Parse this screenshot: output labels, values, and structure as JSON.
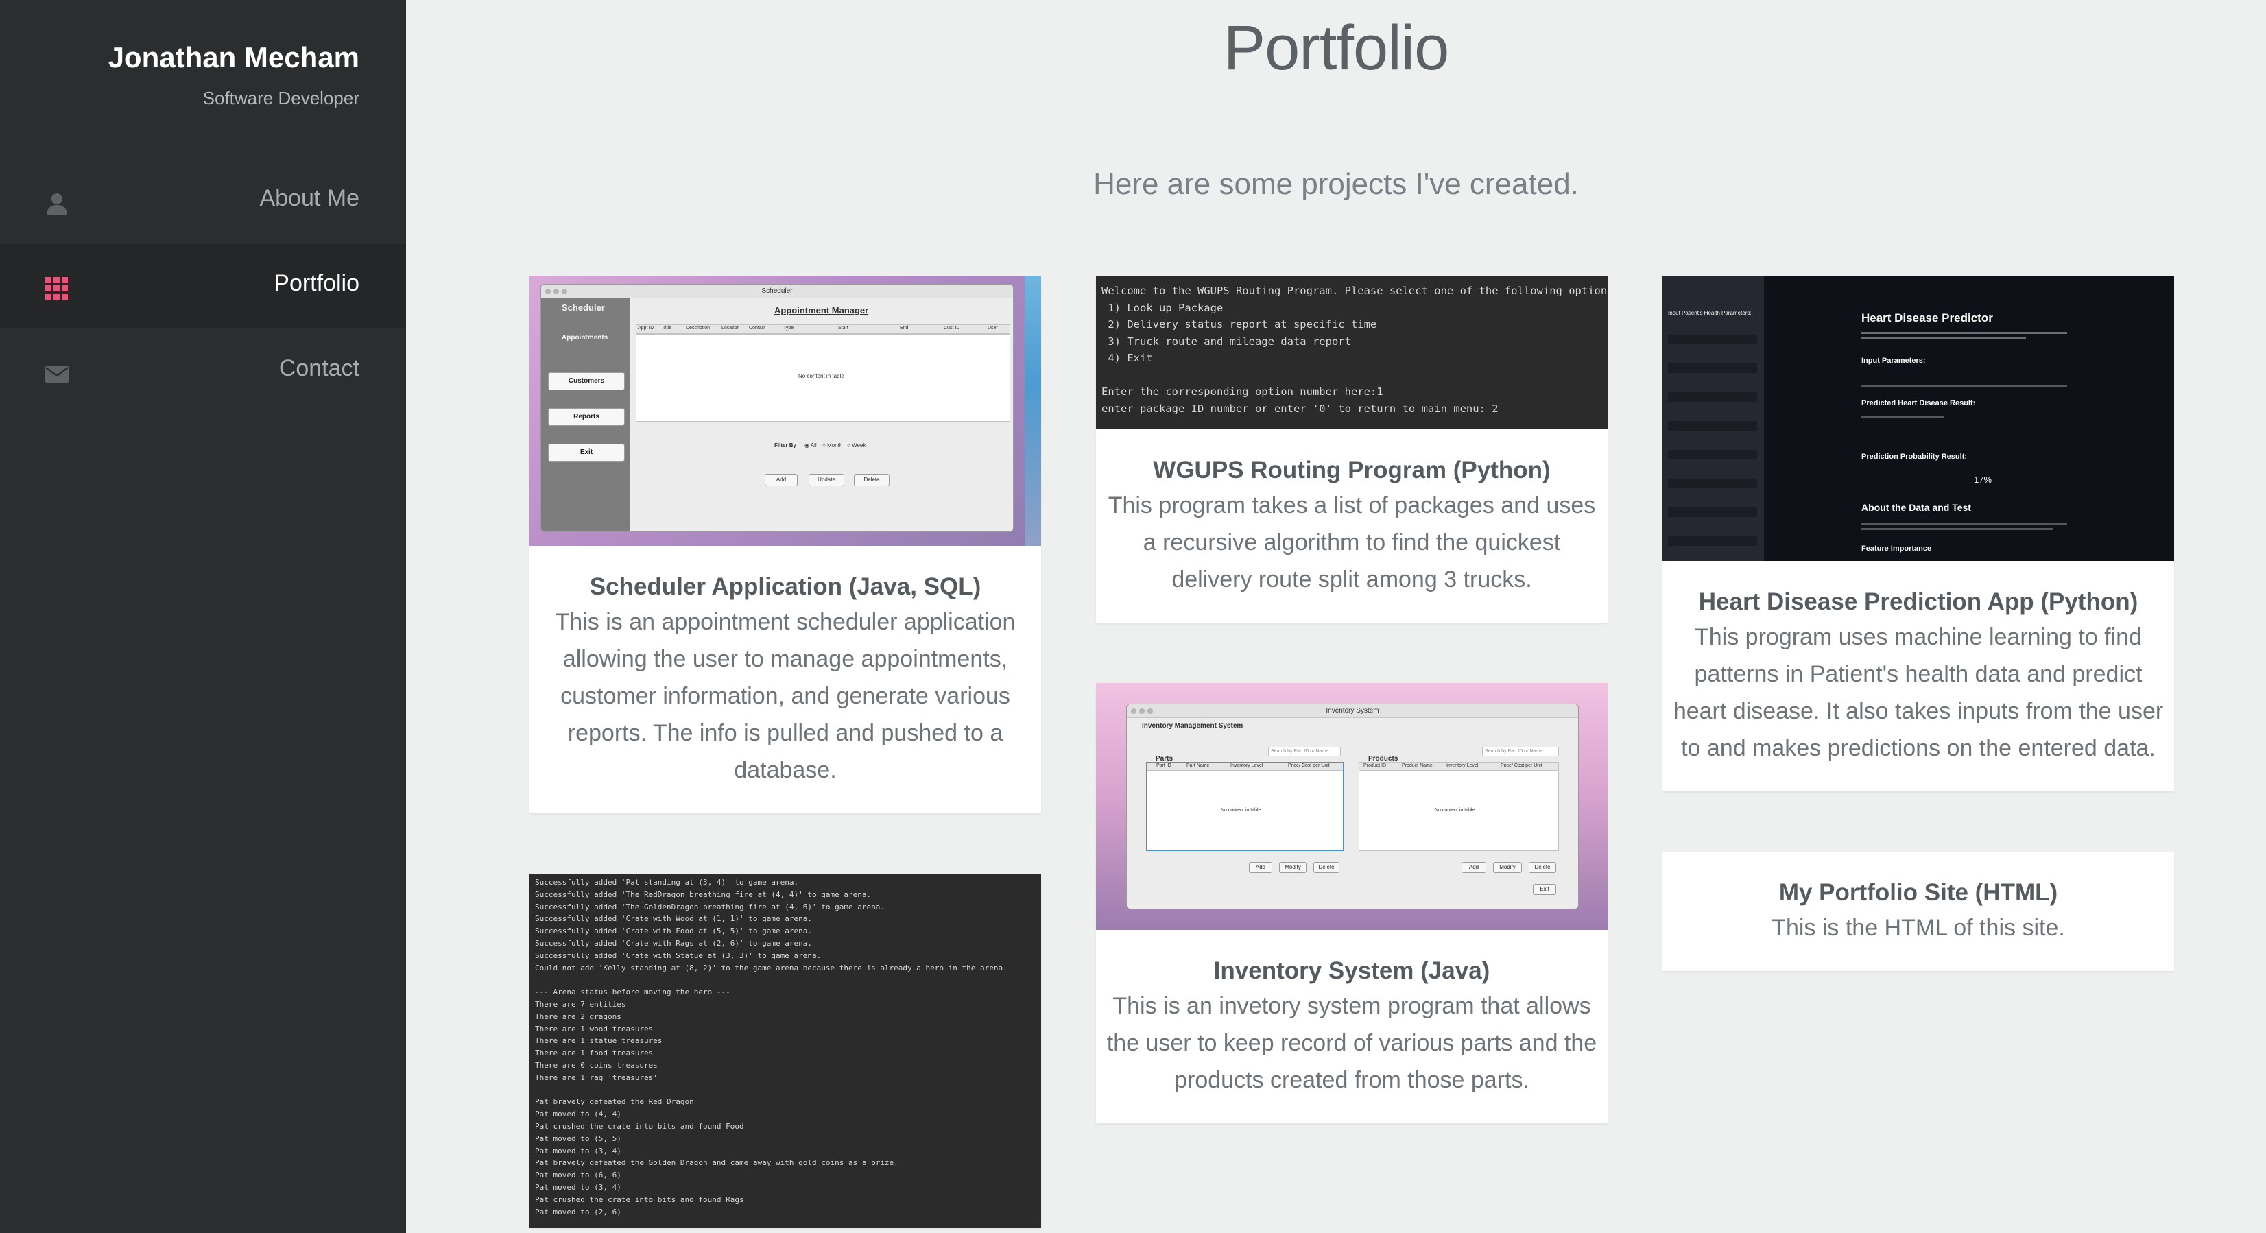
{
  "sidebar": {
    "name": "Jonathan Mecham",
    "role": "Software Developer",
    "nav": [
      {
        "label": "About Me",
        "icon": "person-icon"
      },
      {
        "label": "Portfolio",
        "icon": "grid-icon",
        "active": true
      },
      {
        "label": "Contact",
        "icon": "envelope-icon"
      }
    ]
  },
  "main": {
    "title": "Portfolio",
    "subtitle": "Here are some projects I've created."
  },
  "projects": {
    "scheduler": {
      "title": "Scheduler Application (Java, SQL)",
      "description": "This is an appointment scheduler application allowing the user to manage appointments, customer information, and generate various reports. The info is pulled and pushed to a database.",
      "screenshot": {
        "window_title": "Scheduler",
        "app_header": "Scheduler",
        "appointments_label": "Appointments",
        "heading": "Appointment Manager",
        "side_buttons": [
          "Customers",
          "Reports",
          "Exit"
        ],
        "columns": [
          "Appt ID",
          "Title",
          "Description",
          "Location",
          "Contact",
          "Type",
          "Start",
          "End",
          "Cust ID",
          "User"
        ],
        "empty_text": "No content in table",
        "filter_label": "Filter By",
        "filter_options": [
          "All",
          "Month",
          "Week"
        ],
        "actions": [
          "Add",
          "Update",
          "Delete"
        ]
      }
    },
    "wgups": {
      "title": "WGUPS Routing Program (Python)",
      "description": "This program takes a list of packages and uses a recursive algorithm to find the quickest delivery route split among 3 trucks.",
      "terminal": [
        "Welcome to the WGUPS Routing Program. Please select one of the following options:",
        " 1) Look up Package",
        " 2) Delivery status report at specific time",
        " 3) Truck route and mileage data report",
        " 4) Exit",
        "",
        "Enter the corresponding option number here:1",
        "enter package ID number or enter '0' to return to main menu: 2"
      ]
    },
    "heart": {
      "title": "Heart Disease Prediction App (Python)",
      "description": "This program uses machine learning to find patterns in Patient's health data and predict heart disease. It also takes inputs from the user to and makes predictions on the entered data.",
      "screenshot": {
        "side_title": "Input Patient's Health Parameters:",
        "heading": "Heart Disease Predictor",
        "input_params": "Input Parameters:",
        "predicted": "Predicted Heart Disease Result:",
        "probability": "Prediction Probability Result:",
        "percent": "17%",
        "about": "About the Data and Test",
        "feature": "Feature Importance"
      }
    },
    "inventory": {
      "title": "Inventory System (Java)",
      "description": "This is an invetory system program that allows the user to keep record of various parts and the products created from those parts.",
      "screenshot": {
        "window_title": "Inventory System",
        "heading": "Inventory Management System",
        "parts_label": "Parts",
        "products_label": "Products",
        "parts_search": "Search by Part ID or Name",
        "products_search": "Search by Part ID or Name",
        "parts_columns": [
          "Part ID",
          "Part Name",
          "Inventory Level",
          "Price/ Cost per Unit"
        ],
        "products_columns": [
          "Product ID",
          "Product Name",
          "Inventory Level",
          "Price/ Cost per Unit"
        ],
        "empty_text": "No content in table",
        "parts_actions": [
          "Add",
          "Modify",
          "Delete"
        ],
        "products_actions": [
          "Add",
          "Modify",
          "Delete"
        ],
        "exit": "Exit"
      }
    },
    "portfolio_site": {
      "title": "My Portfolio Site (HTML)",
      "description": "This is the HTML of this site."
    },
    "game": {
      "terminal": [
        "Successfully added 'Pat standing at (3, 4)' to game arena.",
        "Successfully added 'The RedDragon breathing fire at (4, 4)' to game arena.",
        "Successfully added 'The GoldenDragon breathing fire at (4, 6)' to game arena.",
        "Successfully added 'Crate with Wood at (1, 1)' to game arena.",
        "Successfully added 'Crate with Food at (5, 5)' to game arena.",
        "Successfully added 'Crate with Rags at (2, 6)' to game arena.",
        "Successfully added 'Crate with Statue at (3, 3)' to game arena.",
        "Could not add 'Kelly standing at (8, 2)' to the game arena because there is already a hero in the arena.",
        "",
        "--- Arena status before moving the hero ---",
        "There are 7 entities",
        "There are 2 dragons",
        "There are 1 wood treasures",
        "There are 1 statue treasures",
        "There are 1 food treasures",
        "There are 0 coins treasures",
        "There are 1 rag 'treasures'",
        "",
        "Pat bravely defeated the Red Dragon",
        "Pat moved to (4, 4)",
        "Pat crushed the crate into bits and found Food",
        "Pat moved to (5, 5)",
        "Pat moved to (3, 4)",
        "Pat bravely defeated the Golden Dragon and came away with gold coins as a prize.",
        "Pat moved to (6, 6)",
        "Pat moved to (3, 4)",
        "Pat crushed the crate into bits and found Rags",
        "Pat moved to (2, 6)"
      ]
    }
  },
  "colors": {
    "sidebar_bg": "#2b2d2e",
    "sidebar_active": "#242627",
    "page_bg": "#eef0f0",
    "accent_icon": "#e0577a",
    "text_main": "#5c6166"
  }
}
